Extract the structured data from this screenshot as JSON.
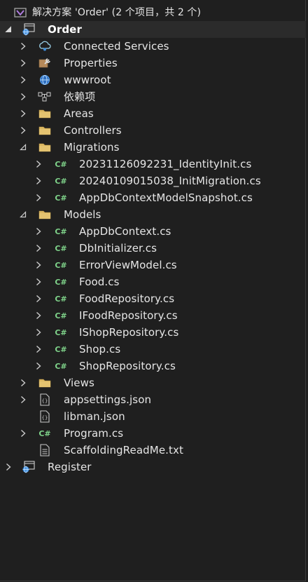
{
  "solution": {
    "title": "解决方案 'Order' (2 个项目，共 2 个)",
    "icon": "visual-studio-solution-icon"
  },
  "tree": [
    {
      "label": "Order",
      "icon": "csharp-project-icon",
      "expander": "expanded-filled",
      "depth": "project",
      "selected": true
    },
    {
      "label": "Connected Services",
      "icon": "connected-services-icon",
      "expander": "collapsed",
      "depth": "1"
    },
    {
      "label": "Properties",
      "icon": "properties-wrench-icon",
      "expander": "collapsed",
      "depth": "1"
    },
    {
      "label": "wwwroot",
      "icon": "globe-icon",
      "expander": "collapsed",
      "depth": "1"
    },
    {
      "label": "依赖项",
      "icon": "dependencies-icon",
      "expander": "collapsed",
      "depth": "1"
    },
    {
      "label": "Areas",
      "icon": "folder-icon",
      "expander": "collapsed",
      "depth": "1"
    },
    {
      "label": "Controllers",
      "icon": "folder-icon",
      "expander": "collapsed",
      "depth": "1"
    },
    {
      "label": "Migrations",
      "icon": "folder-icon",
      "expander": "expanded",
      "depth": "1"
    },
    {
      "label": "20231126092231_IdentityInit.cs",
      "icon": "csharp-file-icon",
      "expander": "collapsed",
      "depth": "2"
    },
    {
      "label": "20240109015038_InitMigration.cs",
      "icon": "csharp-file-icon",
      "expander": "collapsed",
      "depth": "2"
    },
    {
      "label": "AppDbContextModelSnapshot.cs",
      "icon": "csharp-file-icon",
      "expander": "collapsed",
      "depth": "2"
    },
    {
      "label": "Models",
      "icon": "folder-icon",
      "expander": "expanded",
      "depth": "1"
    },
    {
      "label": "AppDbContext.cs",
      "icon": "csharp-file-icon",
      "expander": "collapsed",
      "depth": "2"
    },
    {
      "label": "DbInitializer.cs",
      "icon": "csharp-file-icon",
      "expander": "collapsed",
      "depth": "2"
    },
    {
      "label": "ErrorViewModel.cs",
      "icon": "csharp-file-icon",
      "expander": "collapsed",
      "depth": "2"
    },
    {
      "label": "Food.cs",
      "icon": "csharp-file-icon",
      "expander": "collapsed",
      "depth": "2"
    },
    {
      "label": "FoodRepository.cs",
      "icon": "csharp-file-icon",
      "expander": "collapsed",
      "depth": "2"
    },
    {
      "label": "IFoodRepository.cs",
      "icon": "csharp-file-icon",
      "expander": "collapsed",
      "depth": "2"
    },
    {
      "label": "IShopRepository.cs",
      "icon": "csharp-file-icon",
      "expander": "collapsed",
      "depth": "2"
    },
    {
      "label": "Shop.cs",
      "icon": "csharp-file-icon",
      "expander": "collapsed",
      "depth": "2"
    },
    {
      "label": "ShopRepository.cs",
      "icon": "csharp-file-icon",
      "expander": "collapsed",
      "depth": "2"
    },
    {
      "label": "Views",
      "icon": "folder-icon",
      "expander": "collapsed",
      "depth": "1"
    },
    {
      "label": "appsettings.json",
      "icon": "json-file-icon",
      "expander": "collapsed",
      "depth": "1"
    },
    {
      "label": "libman.json",
      "icon": "json-file-icon",
      "expander": "none",
      "depth": "1"
    },
    {
      "label": "Program.cs",
      "icon": "csharp-file-icon",
      "expander": "collapsed",
      "depth": "1"
    },
    {
      "label": "ScaffoldingReadMe.txt",
      "icon": "text-file-icon",
      "expander": "none",
      "depth": "1"
    },
    {
      "label": "Register",
      "icon": "csharp-project-icon",
      "expander": "collapsed",
      "depth": "project"
    }
  ],
  "colors": {
    "background": "#1f1f1f",
    "text": "#e6e6e6",
    "folder": "#dcb862",
    "csharp": "#7fd38a",
    "project_accent": "#3c8dde",
    "solution_accent": "#b07de0"
  }
}
